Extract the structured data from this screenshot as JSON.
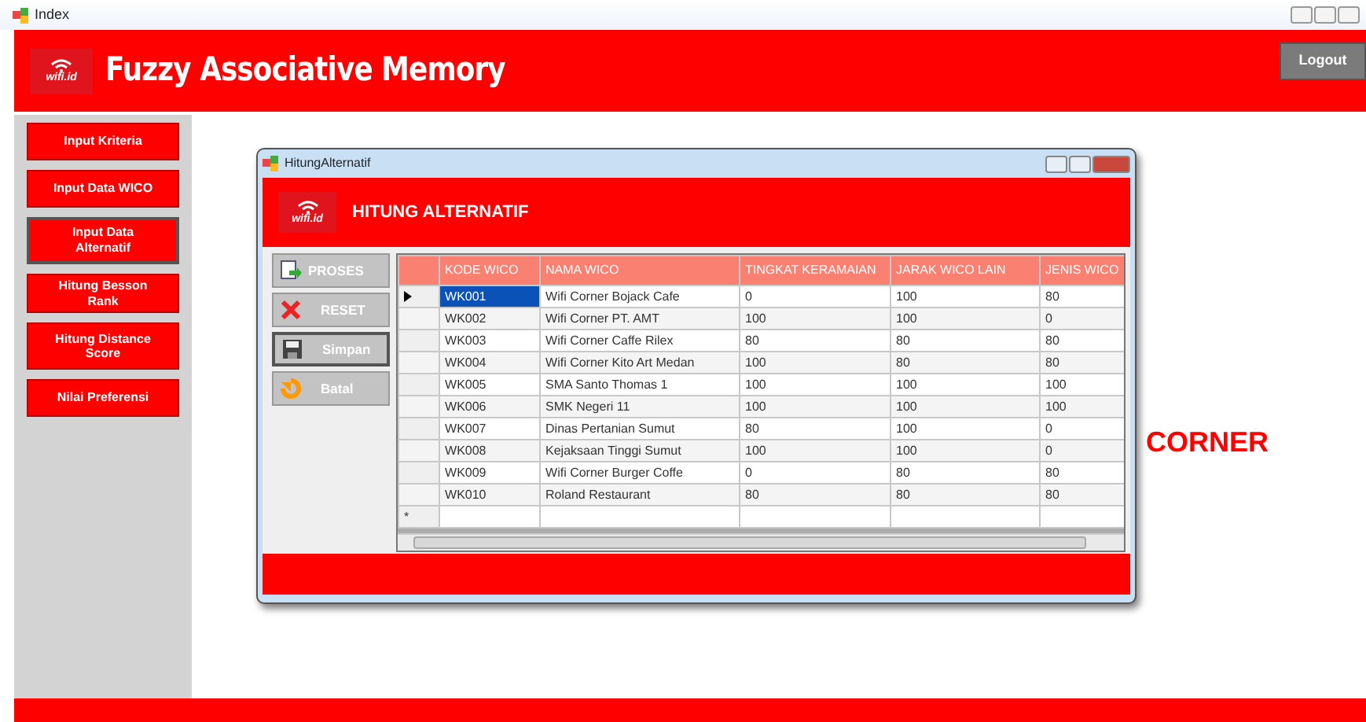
{
  "window": {
    "title": "Index"
  },
  "header": {
    "logo_text": "wifi.id",
    "title": "Fuzzy Associative Memory",
    "logout": "Logout"
  },
  "sidebar": {
    "items": [
      {
        "label": "Input Kriteria",
        "selected": false
      },
      {
        "label": "Input Data WICO",
        "selected": false
      },
      {
        "label": "Input Data Alternatif",
        "selected": true
      },
      {
        "label": "Hitung Besson Rank",
        "selected": false
      },
      {
        "label": "Hitung Distance Score",
        "selected": false
      },
      {
        "label": "Nilai Preferensi",
        "selected": false
      }
    ]
  },
  "corner_text": "CORNER",
  "dialog": {
    "title": "HitungAlternatif",
    "logo_text": "wifi.id",
    "heading": "HITUNG ALTERNATIF",
    "buttons": [
      {
        "kind": "process",
        "label": "PROSES",
        "focused": false
      },
      {
        "kind": "reset",
        "label": "RESET",
        "focused": false
      },
      {
        "kind": "save",
        "label": "Simpan",
        "focused": true
      },
      {
        "kind": "cancel",
        "label": "Batal",
        "focused": false
      }
    ],
    "table": {
      "columns": [
        "KODE WICO",
        "NAMA WICO",
        "TINGKAT KERAMAIAN",
        "JARAK WICO LAIN",
        "JENIS WICO"
      ],
      "new_row_marker": "*",
      "rows": [
        {
          "current": true,
          "cells": [
            "WK001",
            "Wifi Corner Bojack Cafe",
            "0",
            "100",
            "80"
          ],
          "code_selected": true
        },
        {
          "current": false,
          "cells": [
            "WK002",
            "Wifi Corner PT. AMT",
            "100",
            "100",
            "0"
          ],
          "code_selected": false
        },
        {
          "current": false,
          "cells": [
            "WK003",
            "Wifi Corner Caffe Rilex",
            "80",
            "80",
            "80"
          ],
          "code_selected": false
        },
        {
          "current": false,
          "cells": [
            "WK004",
            "Wifi Corner Kito Art Medan",
            "100",
            "80",
            "80"
          ],
          "code_selected": false
        },
        {
          "current": false,
          "cells": [
            "WK005",
            "SMA Santo Thomas 1",
            "100",
            "100",
            "100"
          ],
          "code_selected": false
        },
        {
          "current": false,
          "cells": [
            "WK006",
            "SMK Negeri 11",
            "100",
            "100",
            "100"
          ],
          "code_selected": false
        },
        {
          "current": false,
          "cells": [
            "WK007",
            "Dinas Pertanian Sumut",
            "80",
            "100",
            "0"
          ],
          "code_selected": false
        },
        {
          "current": false,
          "cells": [
            "WK008",
            "Kejaksaan Tinggi Sumut",
            "100",
            "100",
            "0"
          ],
          "code_selected": false
        },
        {
          "current": false,
          "cells": [
            "WK009",
            "Wifi Corner Burger Coffe",
            "0",
            "80",
            "80"
          ],
          "code_selected": false
        },
        {
          "current": false,
          "cells": [
            "WK010",
            "Roland Restaurant",
            "80",
            "80",
            "80"
          ],
          "code_selected": false
        }
      ]
    }
  }
}
